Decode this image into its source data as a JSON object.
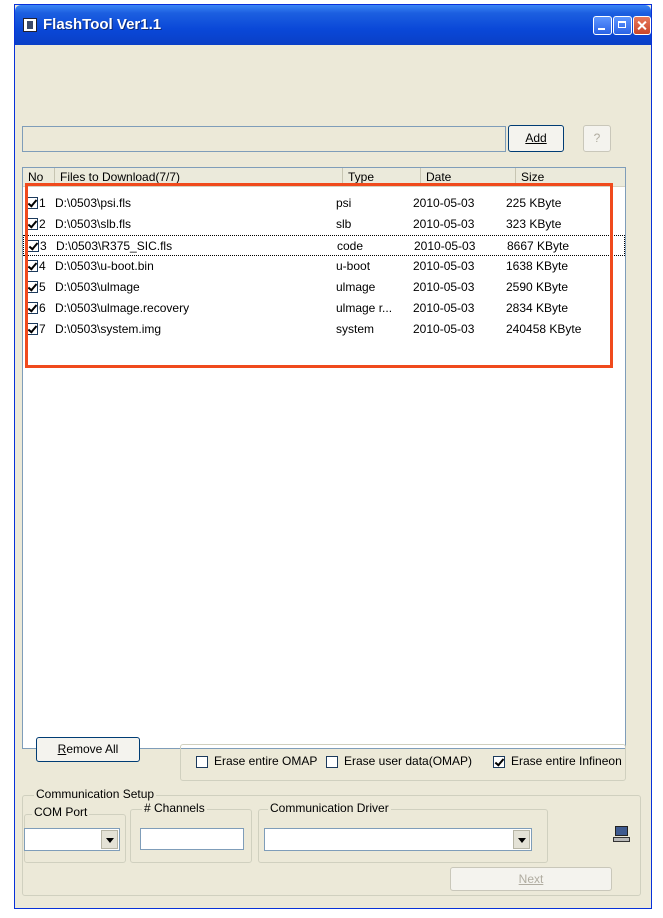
{
  "window": {
    "title": "FlashTool Ver1.1"
  },
  "toolbar": {
    "path_value": "",
    "add_label": "Add",
    "help_label": "?"
  },
  "list": {
    "columns": [
      "No",
      "Files to Download(7/7)",
      "Type",
      "Date",
      "Size"
    ],
    "rows": [
      {
        "no": "1",
        "file": "D:\\0503\\psi.fls",
        "type": "psi",
        "date": "2010-05-03",
        "size": "225 KByte",
        "checked": true
      },
      {
        "no": "2",
        "file": "D:\\0503\\slb.fls",
        "type": "slb",
        "date": "2010-05-03",
        "size": "323 KByte",
        "checked": true
      },
      {
        "no": "3",
        "file": "D:\\0503\\R375_SIC.fls",
        "type": "code",
        "date": "2010-05-03",
        "size": "8667 KByte",
        "checked": true
      },
      {
        "no": "4",
        "file": "D:\\0503\\u-boot.bin",
        "type": "u-boot",
        "date": "2010-05-03",
        "size": "1638 KByte",
        "checked": true
      },
      {
        "no": "5",
        "file": "D:\\0503\\ulmage",
        "type": "ulmage",
        "date": "2010-05-03",
        "size": "2590 KByte",
        "checked": true
      },
      {
        "no": "6",
        "file": "D:\\0503\\ulmage.recovery",
        "type": "ulmage r...",
        "date": "2010-05-03",
        "size": "2834 KByte",
        "checked": true
      },
      {
        "no": "7",
        "file": "D:\\0503\\system.img",
        "type": "system",
        "date": "2010-05-03",
        "size": "240458 KByte",
        "checked": true
      }
    ]
  },
  "actions": {
    "remove_all_underlined": "R",
    "remove_all_rest": "emove All",
    "next_label": "Next"
  },
  "options": {
    "erase_omap": {
      "label": "Erase entire OMAP",
      "checked": false
    },
    "erase_user": {
      "label": "Erase user data(OMAP)",
      "checked": false
    },
    "erase_infineon": {
      "label": "Erase entire Infineon",
      "checked": true
    }
  },
  "comm": {
    "group_label": "Communication Setup",
    "com_port_label": "COM Port",
    "channels_label": "# Channels",
    "driver_label": "Communication Driver",
    "com_port_value": "",
    "channels_value": "",
    "driver_value": ""
  },
  "colors": {
    "highlight": "#f04a1c",
    "titlebar": "#0a48d8",
    "face": "#ece9d8"
  }
}
